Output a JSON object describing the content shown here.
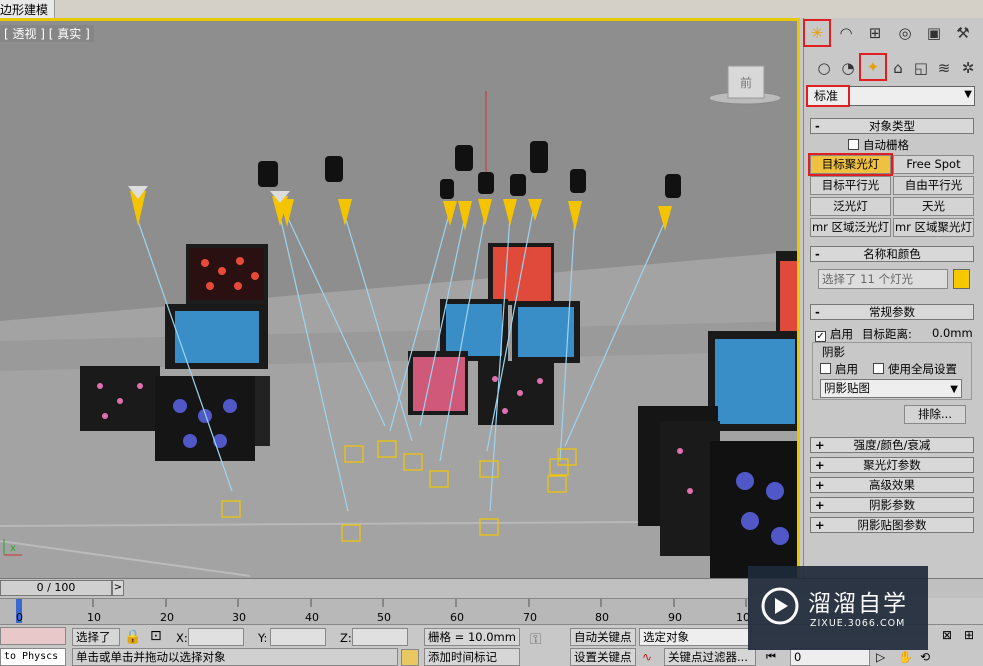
{
  "window": {
    "title": "边形建模"
  },
  "viewport": {
    "label": "[ 透视 ] [ 真实 ]",
    "viewcube_label": "前",
    "axis_label": "x"
  },
  "panel": {
    "tabs": [
      "create-icon",
      "modify-icon",
      "hierarchy-icon",
      "motion-icon",
      "display-icon",
      "utilities-icon"
    ],
    "categories": [
      "geometry-icon",
      "shape-icon",
      "light-icon",
      "camera-icon",
      "helper-icon",
      "spacewarp-icon",
      "systems-icon"
    ],
    "dropdown_value": "标准",
    "object_type": {
      "header": "对象类型",
      "autogrid_label": "自动栅格",
      "buttons": [
        "目标聚光灯",
        "Free Spot",
        "目标平行光",
        "自由平行光",
        "泛光灯",
        "天光",
        "mr 区域泛光灯",
        "mr 区域聚光灯"
      ]
    },
    "name_color": {
      "header": "名称和颜色",
      "name_value": "选择了 11 个灯光",
      "swatch": "#f5c800"
    },
    "general": {
      "header": "常规参数",
      "enable_label": "启用",
      "target_distance_label": "目标距离:",
      "target_distance_value": "0.0mm",
      "shadow_group": "阴影",
      "shadow_enable_label": "启用",
      "global_settings_label": "使用全局设置",
      "shadow_type": "阴影贴图",
      "exclude_label": "排除..."
    },
    "collapsed_rollouts": [
      "强度/颜色/衰减",
      "聚光灯参数",
      "高级效果",
      "阴影参数",
      "阴影贴图参数"
    ]
  },
  "timeline": {
    "frame_display": "0 / 100",
    "next_label": ">",
    "ticks": [
      "0",
      "10",
      "20",
      "30",
      "40",
      "50",
      "60",
      "70",
      "80",
      "90",
      "10"
    ]
  },
  "status": {
    "script_label": "to Physcs (",
    "selection": "选择了",
    "x_label": "X:",
    "y_label": "Y:",
    "z_label": "Z:",
    "grid": "栅格 = 10.0mm",
    "auto_key": "自动关键点",
    "selected_dropdown": "选定对象",
    "set_key": "设置关键点",
    "key_filters": "关键点过滤器...",
    "frame_value": "0",
    "prompt": "单击或单击并拖动以选择对象",
    "add_time_tag": "添加时间标记"
  },
  "watermark": {
    "brand": "溜溜自学",
    "url": "ZIXUE.3066.COM"
  },
  "colors": {
    "viewport_border": "#e8c800",
    "highlight": "#e02020",
    "light_cone": "#f5c400",
    "target_line": "#9cd4f0"
  }
}
